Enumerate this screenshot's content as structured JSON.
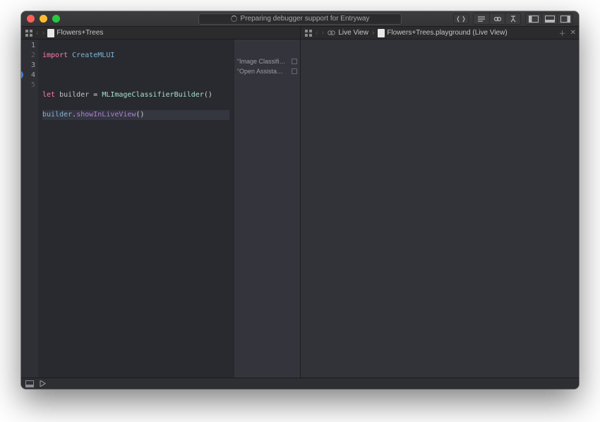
{
  "status_text": "Preparing debugger support for Entryway",
  "left_crumb": {
    "file": "Flowers+Trees"
  },
  "right_crumb": {
    "live_view": "Live View",
    "file": "Flowers+Trees.playground (Live View)"
  },
  "code": {
    "l1_kw": "import",
    "l1_mod": "CreateMLUI",
    "l3_kw": "let",
    "l3_var": "builder",
    "l3_eq": " = ",
    "l3_type": "MLImageClassifierBuilder",
    "l3_call": "()",
    "l4_recv": "builder",
    "l4_dot": ".",
    "l4_fn": "showInLiveView",
    "l4_call": "()"
  },
  "line_numbers": [
    "1",
    "2",
    "3",
    "4",
    "5"
  ],
  "results": {
    "r1": "“Image Classifier Build…",
    "r2": "“Open Assistant Editor…"
  }
}
